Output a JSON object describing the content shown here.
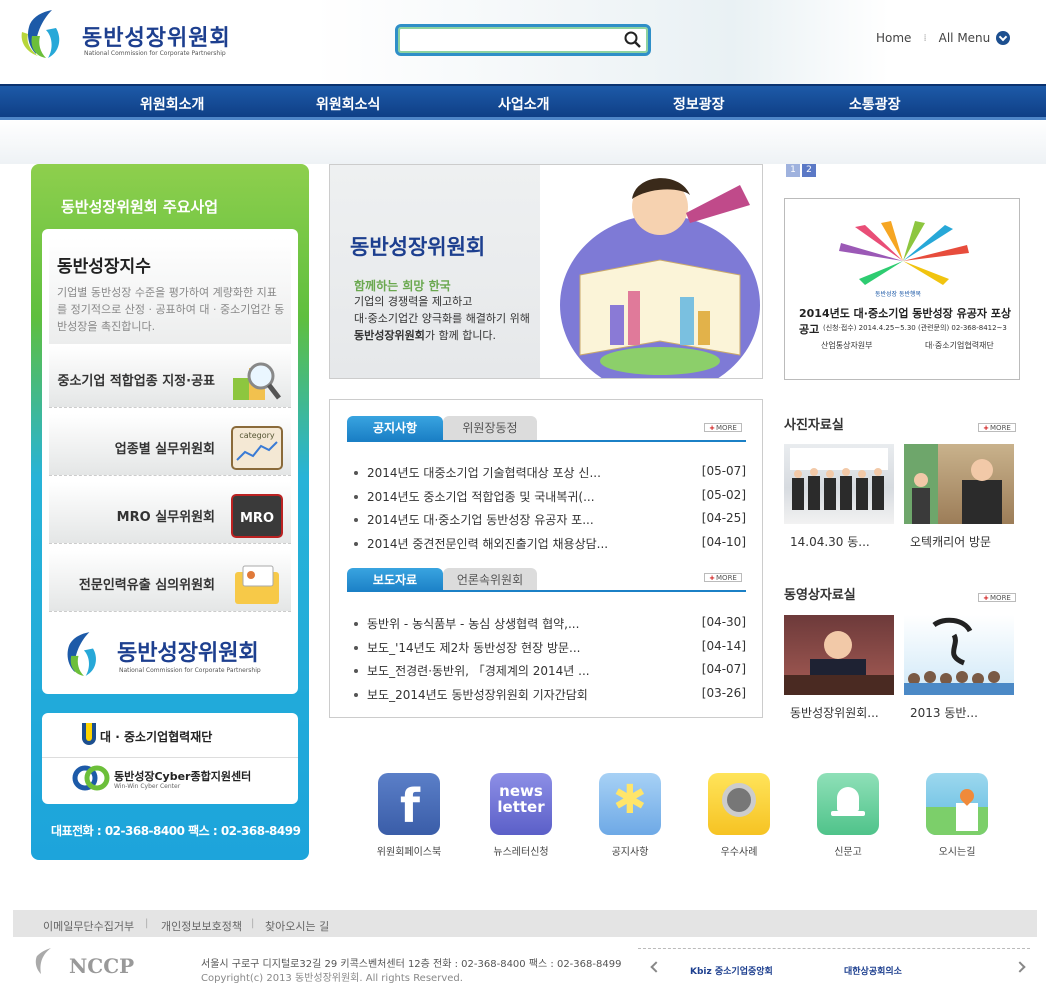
{
  "header": {
    "logo_title": "동반성장위원회",
    "logo_sub": "National Commission for Corporate Partnership",
    "search": {
      "placeholder": "",
      "value": ""
    },
    "util": {
      "home": "Home",
      "all_menu": "All Menu"
    }
  },
  "gnb": {
    "items": [
      "위원회소개",
      "위원회소식",
      "사업소개",
      "정보광장",
      "소통광장"
    ]
  },
  "left_panel": {
    "title": "동반성장위원회 주요사업",
    "index": {
      "title": "동반성장지수",
      "desc": "기업별 동반성장 수준을 평가하여 계량화한 지표를 정기적으로 산정 · 공표하여 대 · 중소기업간 동반성장을 촉진합니다."
    },
    "items": [
      {
        "label": "중소기업 적합업종 지정·공표",
        "icon": "magnifier-chart-icon"
      },
      {
        "label": "업종별 실무위원회",
        "icon": "category-chart-icon",
        "icon_text": "category"
      },
      {
        "label": "MRO 실무위원회",
        "icon": "mro-icon",
        "icon_text": "MRO"
      },
      {
        "label": "전문인력유출 심의위원회",
        "icon": "folder-card-icon"
      }
    ],
    "bottom_logo": {
      "title": "동반성장위원회",
      "sub": "National Commission for Corporate Partnership"
    },
    "partners": {
      "p1": "대 · 중소기업협력재단",
      "p2": "동반성장Cyber종합지원센터",
      "p2_sub": "Win-Win Cyber Center"
    },
    "contact": "대표전화 : 02-368-8400    팩스 : 02-368-8499"
  },
  "banner": {
    "title": "동반성장위원회",
    "sub": "함께하는 희망 한국",
    "line1": "기업의 경쟁력을 제고하고",
    "line2": "대·중소기업간 양극화를 해결하기 위해",
    "line3_strong": "동반성장위원회",
    "line3_rest": "가 함께 합니다."
  },
  "pager": {
    "pages": [
      "1",
      "2"
    ],
    "active": "1"
  },
  "award": {
    "tag": "동반성장 동반행복",
    "title": "2014년도 대·중소기업 동반성장 유공자 포상 공고",
    "detail": "(신청·접수) 2014.4.25~5.30 (관련문의) 02-368-8412~3",
    "org1": "산업통상자원부",
    "org2": "대·중소기업협력재단"
  },
  "notice": {
    "tab_on": "공지사항",
    "tab_off": "위원장동정",
    "more": "MORE",
    "items": [
      {
        "title": "2014년도 대중소기업 기술협력대상 포상 신...",
        "date": "[05-07]"
      },
      {
        "title": "2014년도 중소기업 적합업종 및 국내복귀(...",
        "date": "[05-02]"
      },
      {
        "title": "2014년도 대·중소기업 동반성장 유공자 포...",
        "date": "[04-25]"
      },
      {
        "title": "2014년 중견전문인력 해외진출기업 채용상담...",
        "date": "[04-10]"
      }
    ]
  },
  "press": {
    "tab_on": "보도자료",
    "tab_off": "언론속위원회",
    "more": "MORE",
    "items": [
      {
        "title": "동반위 - 농식품부 - 농심 상생협력 협약,...",
        "date": "[04-30]"
      },
      {
        "title": "보도_'14년도 제2차 동반성장 현장 방문...",
        "date": "[04-14]"
      },
      {
        "title": "보도_전경련·동반위, 「경제계의 2014년 ...",
        "date": "[04-07]"
      },
      {
        "title": "보도_2014년도 동반성장위원회 기자간담회",
        "date": "[03-26]"
      }
    ]
  },
  "photos": {
    "title": "사진자료실",
    "more": "MORE",
    "items": [
      {
        "caption": "14.04.30 동..."
      },
      {
        "caption": "오텍캐리어 방문"
      }
    ]
  },
  "videos": {
    "title": "동영상자료실",
    "more": "MORE",
    "items": [
      {
        "caption": "동반성장위원회..."
      },
      {
        "caption": "2013 동반..."
      }
    ]
  },
  "quick": [
    {
      "label": "위원회페이스북",
      "icon": "facebook-icon"
    },
    {
      "label": "뉴스레터신청",
      "icon": "newsletter-icon",
      "icon_text": "news letter"
    },
    {
      "label": "공지사항",
      "icon": "star-notice-icon"
    },
    {
      "label": "우수사례",
      "icon": "medal-icon"
    },
    {
      "label": "신문고",
      "icon": "bell-icon"
    },
    {
      "label": "오시는길",
      "icon": "map-pin-icon"
    }
  ],
  "footer": {
    "links": [
      "이메일무단수집거부",
      "개인정보보호정책",
      "찾아오시는 길"
    ],
    "logo": "NCCP",
    "address": "서울시 구로구 디지털로32길 29 키콕스벤처센터 12층     전화 : 02-368-8400     팩스 : 02-368-8499",
    "copyright": "Copyright(c) 2013 동반성장위원회. All rights Reserved.",
    "banner1": "Kbiz 중소기업중앙회",
    "banner2": "대한상공회의소"
  },
  "colors": {
    "brand_navy": "#1d3f8f",
    "gnb_blue": "#1d5aa8",
    "tab_blue": "#1b80c6",
    "panel_green": "#8ecf4d",
    "panel_blue": "#1da4db"
  }
}
